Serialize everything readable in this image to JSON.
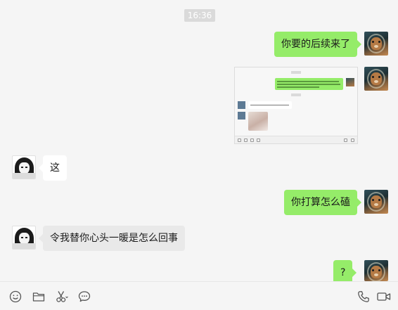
{
  "chat": {
    "timestamp": "16:36",
    "messages": [
      {
        "id": "m1",
        "side": "out",
        "type": "text",
        "text": "你要的后续来了"
      },
      {
        "id": "m2",
        "side": "out",
        "type": "image"
      },
      {
        "id": "m3",
        "side": "in",
        "type": "text",
        "text": "这"
      },
      {
        "id": "m4",
        "side": "out",
        "type": "text",
        "text": "你打算怎么磕"
      },
      {
        "id": "m5",
        "side": "in",
        "type": "text",
        "text": "令我替你心头一暖是怎么回事"
      },
      {
        "id": "m6",
        "side": "out",
        "type": "text",
        "text": "?"
      }
    ]
  },
  "toolbar": {
    "left_icons": [
      "emoji-icon",
      "folder-icon",
      "scissors-icon",
      "chat-history-icon"
    ],
    "right_icons": [
      "phone-icon",
      "video-icon"
    ]
  },
  "colors": {
    "background": "#f5f5f5",
    "outgoing_bubble": "#95ec69",
    "incoming_bubble": "#ffffff",
    "timestamp_bg": "#dadada"
  }
}
